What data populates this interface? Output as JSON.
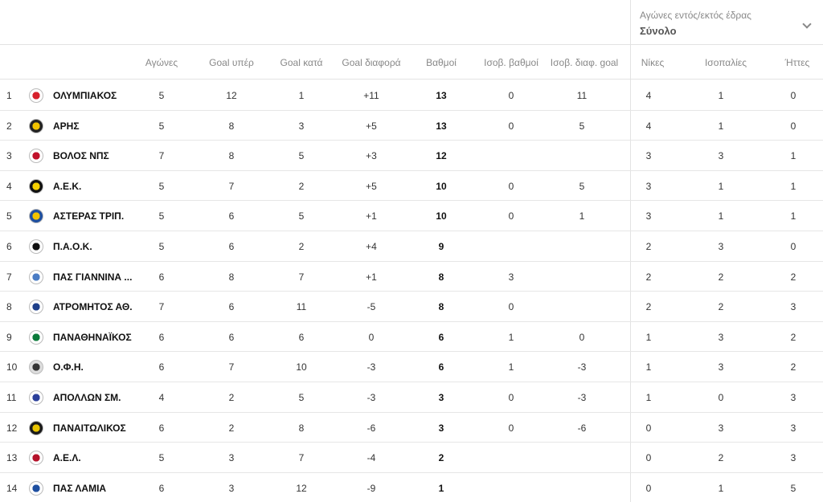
{
  "filter": {
    "label": "Αγώνες εντός/εκτός έδρας",
    "value": "Σύνολο"
  },
  "columns": {
    "played": "Αγώνες",
    "gf": "Goal υπέρ",
    "ga": "Goal κατά",
    "gd": "Goal διαφορά",
    "pts": "Βαθμοί",
    "h2h_pts": "Ισοβ. βαθμοί",
    "h2h_gd": "Ισοβ. διαφ. goal",
    "w": "Νίκες",
    "d": "Ισοπαλίες",
    "l": "Ήττες"
  },
  "rows": [
    {
      "pos": "1",
      "team": "ΟΛΥΜΠΙΑΚΟΣ",
      "played": "5",
      "gf": "12",
      "ga": "1",
      "gd": "+11",
      "pts": "13",
      "h2h_pts": "0",
      "h2h_gd": "11",
      "w": "4",
      "d": "1",
      "l": "0",
      "logo_color": "#d6202b",
      "logo_bg": "#ffffff"
    },
    {
      "pos": "2",
      "team": "ΑΡΗΣ",
      "played": "5",
      "gf": "8",
      "ga": "3",
      "gd": "+5",
      "pts": "13",
      "h2h_pts": "0",
      "h2h_gd": "5",
      "w": "4",
      "d": "1",
      "l": "0",
      "logo_color": "#f2c300",
      "logo_bg": "#222222"
    },
    {
      "pos": "3",
      "team": "ΒΟΛΟΣ ΝΠΣ",
      "played": "7",
      "gf": "8",
      "ga": "5",
      "gd": "+3",
      "pts": "12",
      "h2h_pts": "",
      "h2h_gd": "",
      "w": "3",
      "d": "3",
      "l": "1",
      "logo_color": "#c0102a",
      "logo_bg": "#ffffff"
    },
    {
      "pos": "4",
      "team": "Α.Ε.Κ.",
      "played": "5",
      "gf": "7",
      "ga": "2",
      "gd": "+5",
      "pts": "10",
      "h2h_pts": "0",
      "h2h_gd": "5",
      "w": "3",
      "d": "1",
      "l": "1",
      "logo_color": "#f5d000",
      "logo_bg": "#111111"
    },
    {
      "pos": "5",
      "team": "ΑΣΤΕΡΑΣ ΤΡΙΠ.",
      "played": "5",
      "gf": "6",
      "ga": "5",
      "gd": "+1",
      "pts": "10",
      "h2h_pts": "0",
      "h2h_gd": "1",
      "w": "3",
      "d": "1",
      "l": "1",
      "logo_color": "#f2c300",
      "logo_bg": "#1e4fa0"
    },
    {
      "pos": "6",
      "team": "Π.Α.Ο.Κ.",
      "played": "5",
      "gf": "6",
      "ga": "2",
      "gd": "+4",
      "pts": "9",
      "h2h_pts": "",
      "h2h_gd": "",
      "w": "2",
      "d": "3",
      "l": "0",
      "logo_color": "#111111",
      "logo_bg": "#ffffff"
    },
    {
      "pos": "7",
      "team": "ΠΑΣ ΓΙΑΝΝΙΝΑ ...",
      "played": "6",
      "gf": "8",
      "ga": "7",
      "gd": "+1",
      "pts": "8",
      "h2h_pts": "3",
      "h2h_gd": "",
      "w": "2",
      "d": "2",
      "l": "2",
      "logo_color": "#4a7cc4",
      "logo_bg": "#ffffff"
    },
    {
      "pos": "8",
      "team": "ΑΤΡΟΜΗΤΟΣ ΑΘ.",
      "played": "7",
      "gf": "6",
      "ga": "11",
      "gd": "-5",
      "pts": "8",
      "h2h_pts": "0",
      "h2h_gd": "",
      "w": "2",
      "d": "2",
      "l": "3",
      "logo_color": "#1e3f8a",
      "logo_bg": "#ffffff"
    },
    {
      "pos": "9",
      "team": "ΠΑΝΑΘΗΝΑΪΚΟΣ",
      "played": "6",
      "gf": "6",
      "ga": "6",
      "gd": "0",
      "pts": "6",
      "h2h_pts": "1",
      "h2h_gd": "0",
      "w": "1",
      "d": "3",
      "l": "2",
      "logo_color": "#0a7a3a",
      "logo_bg": "#ffffff"
    },
    {
      "pos": "10",
      "team": "Ο.Φ.Η.",
      "played": "6",
      "gf": "7",
      "ga": "10",
      "gd": "-3",
      "pts": "6",
      "h2h_pts": "1",
      "h2h_gd": "-3",
      "w": "1",
      "d": "3",
      "l": "2",
      "logo_color": "#333333",
      "logo_bg": "#dddddd"
    },
    {
      "pos": "11",
      "team": "ΑΠΟΛΛΩΝ ΣΜ.",
      "played": "4",
      "gf": "2",
      "ga": "5",
      "gd": "-3",
      "pts": "3",
      "h2h_pts": "0",
      "h2h_gd": "-3",
      "w": "1",
      "d": "0",
      "l": "3",
      "logo_color": "#2b3f9a",
      "logo_bg": "#ffffff"
    },
    {
      "pos": "12",
      "team": "ΠΑΝΑΙΤΩΛΙΚΟΣ",
      "played": "6",
      "gf": "2",
      "ga": "8",
      "gd": "-6",
      "pts": "3",
      "h2h_pts": "0",
      "h2h_gd": "-6",
      "w": "0",
      "d": "3",
      "l": "3",
      "logo_color": "#e8c400",
      "logo_bg": "#1a1a1a"
    },
    {
      "pos": "13",
      "team": "Α.Ε.Λ.",
      "played": "5",
      "gf": "3",
      "ga": "7",
      "gd": "-4",
      "pts": "2",
      "h2h_pts": "",
      "h2h_gd": "",
      "w": "0",
      "d": "2",
      "l": "3",
      "logo_color": "#b5122a",
      "logo_bg": "#ffffff"
    },
    {
      "pos": "14",
      "team": "ΠΑΣ ΛΑΜΙΑ",
      "played": "6",
      "gf": "3",
      "ga": "12",
      "gd": "-9",
      "pts": "1",
      "h2h_pts": "",
      "h2h_gd": "",
      "w": "0",
      "d": "1",
      "l": "5",
      "logo_color": "#1e4fa0",
      "logo_bg": "#ffffff"
    }
  ]
}
